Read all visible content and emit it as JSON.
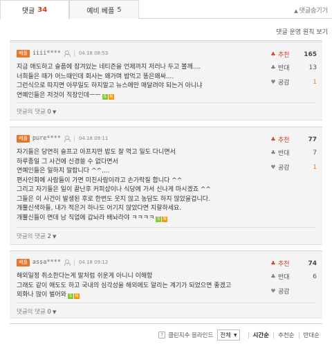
{
  "tabs": [
    {
      "label": "댓글",
      "count": "34"
    },
    {
      "label": "예비 베플",
      "count": "5"
    }
  ],
  "hide_comments": "댓글숨기기",
  "policy_link": "댓글 운영 원칙 보기",
  "comments": [
    {
      "badge": "베플",
      "nick": "iiii****",
      "time": "04.18 08:53",
      "lines": [
        "지금 애도하고 슬픔에 잠겨있는 네티즌을 언제까지 저러나 두고 볼께....",
        "너희들은 때가 어느때인데 회사는 왜가며 밥먹고 똥은왜싸....",
        "그런식으로 따지면 아무일도 하지말고 뉴스에만 매달려야 되는거 아니냐",
        "연예인들은 저것이 직장인데ㅡㅡ"
      ],
      "replies_label": "댓글의 댓글",
      "replies_count": "0",
      "up_label": "추천",
      "up": "165",
      "down_label": "반대",
      "down": "13",
      "agree_label": "공감",
      "agree": "1"
    },
    {
      "badge": "베플",
      "nick": "pure****",
      "time": "04.18 09:11",
      "lines": [
        "자기들은 당연히 슬프고 아프지만 밥도 잘 먹고 일도 다니면서",
        "하루종일 그 사건에 신경쓸 수 없다면서",
        "연예인들은 일하지 말랍니다 ^^....",
        "편사인회에 사람들이 가면 미친사람이라고 손가락질 합니다 ^^",
        "그리고 자기들은 일이 끝난후 커피샵이나 식당에 가서 신나게 마시겠죠 ^^",
        "그들은 이 사건이 발생된 후로 한번도 웃지 않고 농담도 하지 않았을겁니다.",
        "개뿔신색하들, 내가 적은거 하나도 어기지 않았다면 지랄하세요.",
        "개뿔신들이 면데 남 직업에 갑놔라 배놔라야 ㅋㅋㅋㅋ"
      ],
      "replies_label": "댓글의 댓글",
      "replies_count": "2",
      "up_label": "추천",
      "up": "77",
      "down_label": "반대",
      "down": "7",
      "agree_label": "공감",
      "agree": "1"
    },
    {
      "badge": "베플",
      "nick": "assa****",
      "time": "04.18 09:12",
      "lines": [
        "해외일정 취소한다는게 말처럼 쉬운게 아니니 이해함",
        "그래도 같이 애도도 하고 국내의 심각성을 해외에도 알리는 계기가 되었으면 좋겠고",
        "외화나 많이 벌어와"
      ],
      "replies_label": "댓글의 댓글",
      "replies_count": "0",
      "up_label": "추천",
      "up": "74",
      "down_label": "반대",
      "down": "6",
      "agree_label": "공감",
      "agree": ""
    }
  ],
  "footer": {
    "cleanbot": "클린지수 블라인드",
    "filter_value": "전체",
    "sort_time": "시간순",
    "sort_up": "추천순",
    "sort_down": "반대순"
  },
  "colors": {
    "accent": "#d23b1e",
    "badge": "#e8732a",
    "box_bg": "#f4f4f4"
  }
}
